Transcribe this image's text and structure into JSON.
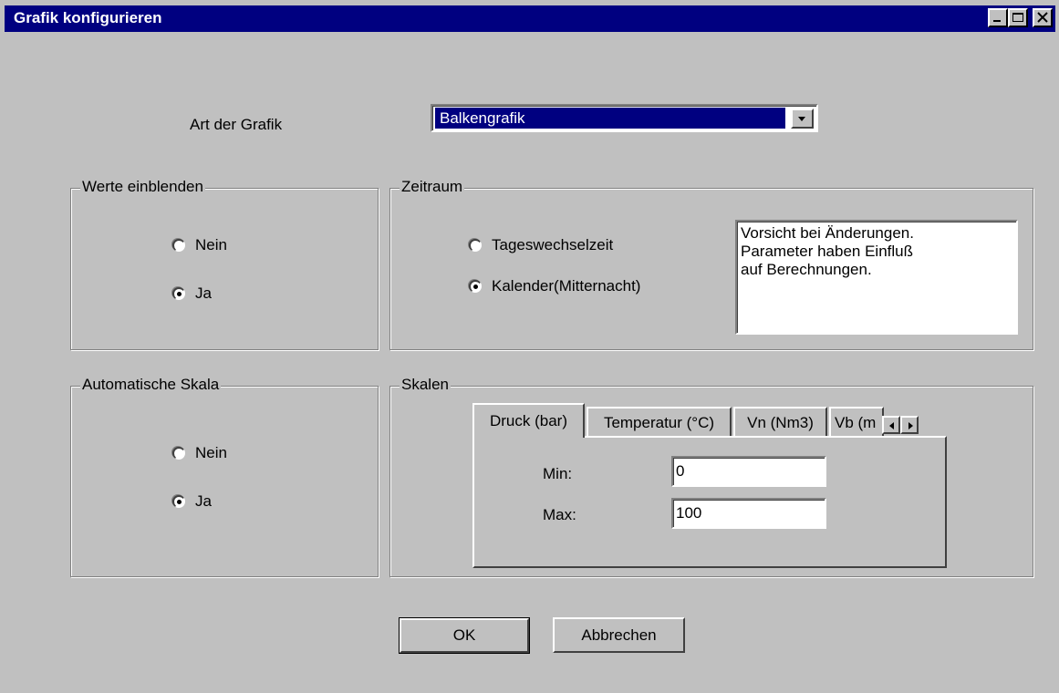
{
  "window": {
    "title": "Grafik konfigurieren"
  },
  "chart_type": {
    "label": "Art der Grafik",
    "selected": "Balkengrafik"
  },
  "values_group": {
    "legend": "Werte einblenden",
    "options": [
      "Nein",
      "Ja"
    ],
    "selected": "Ja"
  },
  "period_group": {
    "legend": "Zeitraum",
    "options": [
      "Tageswechselzeit",
      "Kalender(Mitternacht)"
    ],
    "selected": "Kalender(Mitternacht)",
    "note_lines": [
      "Vorsicht bei Änderungen.",
      "Parameter haben Einfluß",
      "auf Berechnungen."
    ]
  },
  "auto_scale_group": {
    "legend": "Automatische Skala",
    "options": [
      "Nein",
      "Ja"
    ],
    "selected": "Ja"
  },
  "scales_group": {
    "legend": "Skalen",
    "tabs": [
      "Druck (bar)",
      "Temperatur (°C)",
      "Vn (Nm3)",
      "Vb (m"
    ],
    "active_tab": "Druck (bar)",
    "min_label": "Min:",
    "min_value": "0",
    "max_label": "Max:",
    "max_value": "100"
  },
  "buttons": {
    "ok": "OK",
    "cancel": "Abbrechen"
  },
  "icons": {
    "minimize": "minimize-icon",
    "maximize": "maximize-icon",
    "close": "close-icon",
    "dropdown": "chevron-down-icon",
    "tab_left": "arrow-left-icon",
    "tab_right": "arrow-right-icon"
  }
}
